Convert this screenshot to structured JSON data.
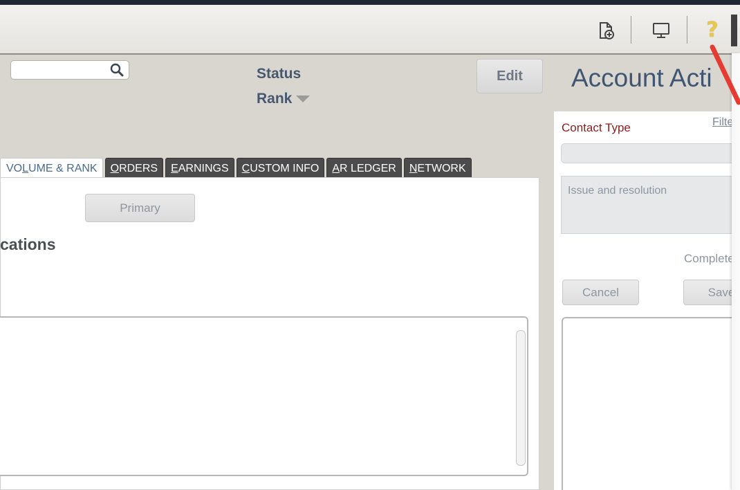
{
  "toolbar": {
    "icons": [
      "new-document-icon",
      "monitor-icon",
      "help-icon"
    ],
    "help_glyph": "?"
  },
  "search": {
    "value": "",
    "placeholder": ""
  },
  "header": {
    "status_label": "Status",
    "rank_label": "Rank",
    "edit_label": "Edit",
    "account_title": "Account Acti"
  },
  "tabs": [
    {
      "pre": "VO",
      "ul": "L",
      "post": "UME & RANK",
      "active": true
    },
    {
      "pre": "",
      "ul": "O",
      "post": "RDERS",
      "active": false
    },
    {
      "pre": "",
      "ul": "E",
      "post": "ARNINGS",
      "active": false
    },
    {
      "pre": "",
      "ul": "C",
      "post": "USTOM INFO",
      "active": false
    },
    {
      "pre": "",
      "ul": "A",
      "post": "R LEDGER",
      "active": false
    },
    {
      "pre": "",
      "ul": "N",
      "post": "ETWORK",
      "active": false
    }
  ],
  "panel": {
    "primary_label": "Primary",
    "section_title": "cations"
  },
  "side": {
    "contact_type_label": "Contact Type",
    "filter_link": "Filter",
    "contact_type_value": "",
    "issue_placeholder": "Issue and resolution",
    "completed_label": "Completed",
    "cancel_label": "Cancel",
    "save_label": "Save"
  },
  "colors": {
    "accent_title": "#3f5673",
    "tab_dark": "#4b4b4b",
    "required_label": "#8b1c1c",
    "help_icon": "#e8c84a",
    "annotation_arrow": "#e53b32"
  }
}
